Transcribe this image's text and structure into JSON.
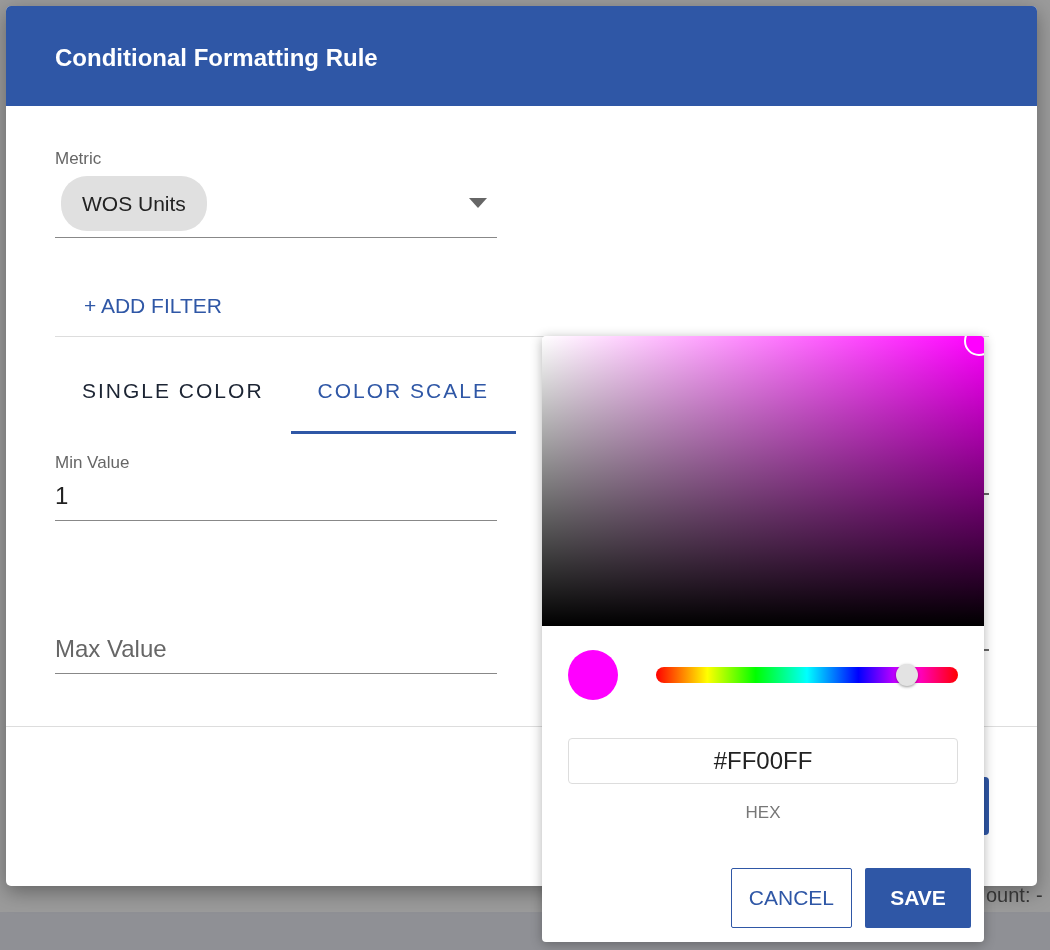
{
  "backdrop": {
    "fragment": "ount: -"
  },
  "dialog": {
    "title": "Conditional Formatting Rule",
    "metric": {
      "label": "Metric",
      "chip": "WOS Units"
    },
    "add_filter": "+ ADD FILTER",
    "tabs": [
      {
        "label": "SINGLE COLOR",
        "selected": false
      },
      {
        "label": "COLOR SCALE",
        "selected": true
      }
    ],
    "min_field": {
      "label": "Min Value",
      "value": "1"
    },
    "max_field": {
      "placeholder": "Max Value"
    }
  },
  "color_picker": {
    "hue": {
      "level": 0.83
    },
    "hex": {
      "value": "#FF00FF",
      "label": "HEX"
    },
    "buttons": [
      {
        "label": "CANCEL",
        "kind": "outline"
      },
      {
        "label": "SAVE",
        "kind": "filled"
      }
    ]
  }
}
